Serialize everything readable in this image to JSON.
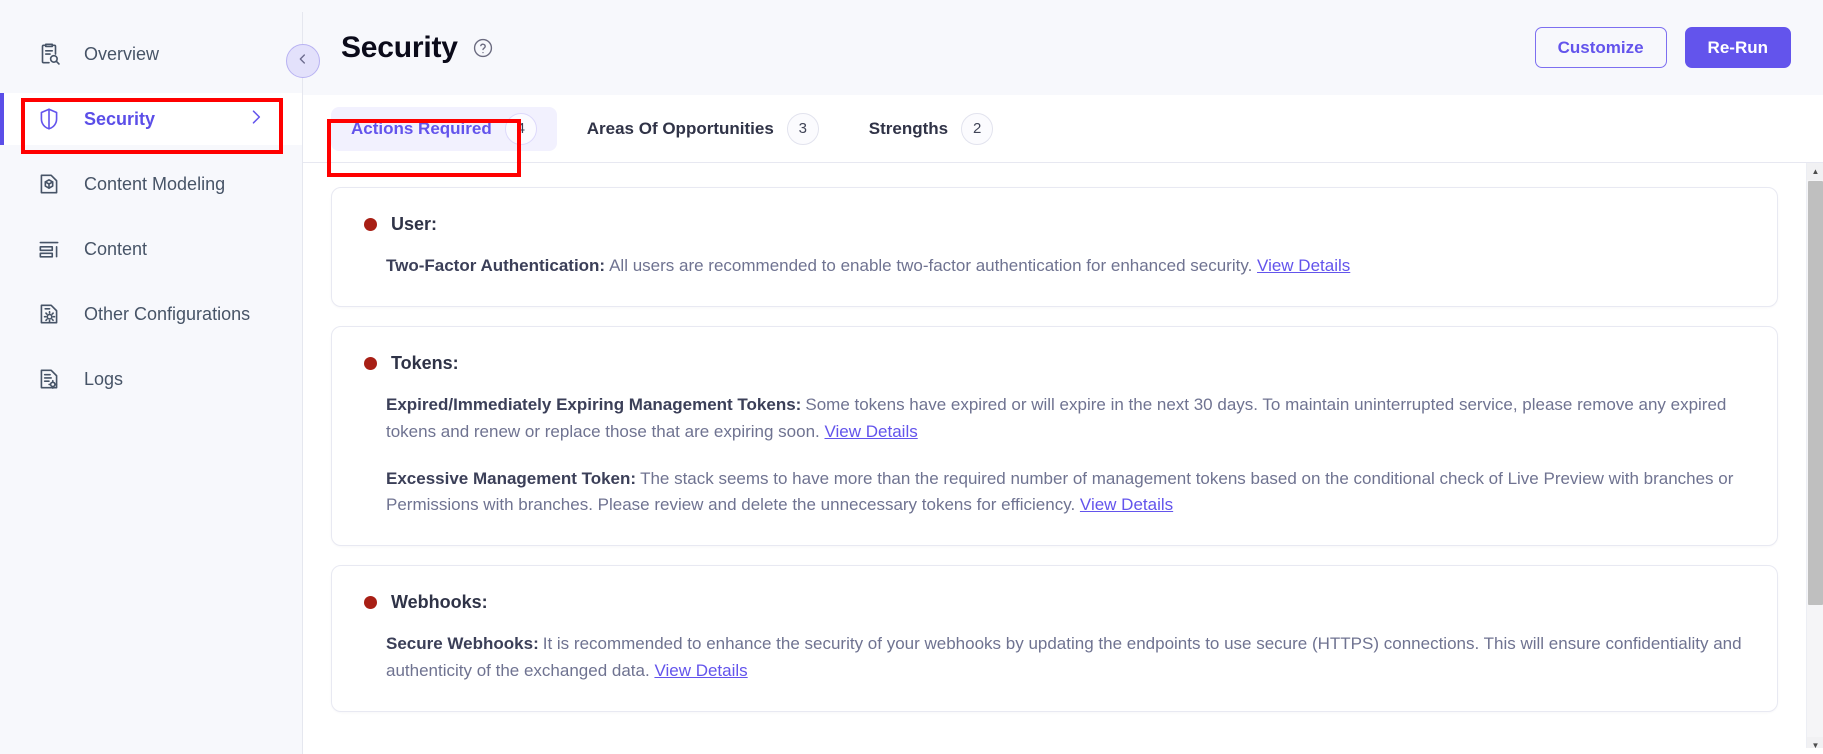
{
  "sidebar": {
    "items": [
      {
        "label": "Overview",
        "icon": "clipboard-search-icon",
        "active": false
      },
      {
        "label": "Security",
        "icon": "shield-icon",
        "active": true
      },
      {
        "label": "Content Modeling",
        "icon": "content-model-icon",
        "active": false
      },
      {
        "label": "Content",
        "icon": "content-list-icon",
        "active": false
      },
      {
        "label": "Other Configurations",
        "icon": "configuration-gear-icon",
        "active": false
      },
      {
        "label": "Logs",
        "icon": "logs-icon",
        "active": false
      }
    ]
  },
  "header": {
    "title": "Security",
    "help_icon": "question-circle-icon",
    "collapse_icon": "chevron-left-icon",
    "customize_label": "Customize",
    "rerun_label": "Re-Run"
  },
  "tabs": [
    {
      "label": "Actions Required",
      "count": "4",
      "active": true
    },
    {
      "label": "Areas Of Opportunities",
      "count": "3",
      "active": false
    },
    {
      "label": "Strengths",
      "count": "2",
      "active": false
    }
  ],
  "cards": [
    {
      "title": "User:",
      "findings": [
        {
          "label": "Two-Factor Authentication:",
          "text": "All users are recommended to enable two-factor authentication for enhanced security.",
          "link": "View Details"
        }
      ]
    },
    {
      "title": "Tokens:",
      "findings": [
        {
          "label": "Expired/Immediately Expiring Management Tokens:",
          "text": "Some tokens have expired or will expire in the next 30 days. To maintain uninterrupted service, please remove any expired tokens and renew or replace those that are expiring soon.",
          "link": "View Details"
        },
        {
          "label": "Excessive Management Token:",
          "text": "The stack seems to have more than the required number of management tokens based on the conditional check of Live Preview with branches or Permissions with branches. Please review and delete the unnecessary tokens for efficiency.",
          "link": "View Details"
        }
      ]
    },
    {
      "title": "Webhooks:",
      "findings": [
        {
          "label": "Secure Webhooks:",
          "text": "It is recommended to enhance the security of your webhooks by updating the endpoints to use secure (HTTPS) connections. This will ensure confidentiality and authenticity of the exchanged data.",
          "link": "View Details"
        }
      ]
    }
  ],
  "colors": {
    "accent": "#6354ec",
    "severity_dot": "#a81f15",
    "highlight_box": "#ff0000",
    "sidebar_bg": "#f7f8fc"
  },
  "scrollbar": {
    "up_arrow": "▲",
    "down_arrow": "▼"
  }
}
